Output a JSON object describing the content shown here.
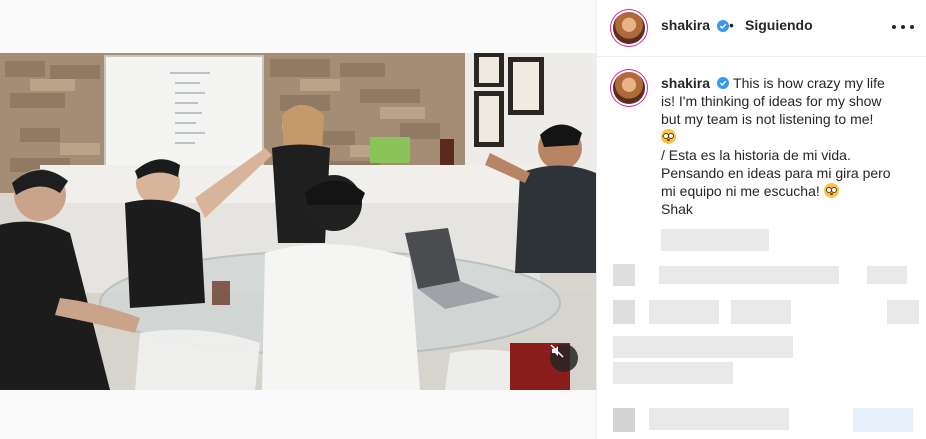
{
  "post": {
    "username": "shakira",
    "follow_status": "Siguiendo",
    "separator": "•",
    "caption_lines": [
      "This is how crazy my life",
      "is! I'm thinking of ideas for my show",
      "but my team is not listening to me!",
      "/ Esta es la historia de mi vida.",
      "Pensando en ideas para mi gira pero",
      "mi equipo ni me escucha!",
      "Shak"
    ]
  },
  "icons": {
    "verified": "verified-badge-icon",
    "more": "more-options-icon",
    "mute": "muted-speaker-icon",
    "emoji": "rolling-eyes-emoji"
  },
  "colors": {
    "verified_blue": "#3897f0",
    "text": "#262626",
    "border": "#efefef"
  }
}
